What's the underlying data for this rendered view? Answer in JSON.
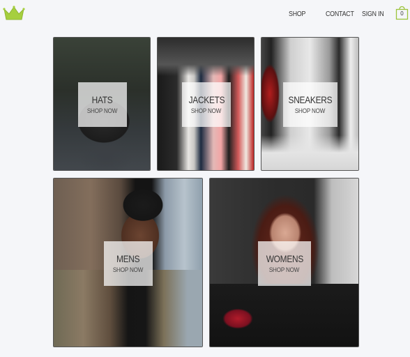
{
  "header": {
    "nav": {
      "shop": "SHOP",
      "contact": "CONTACT",
      "sign_in": "SIGN IN"
    },
    "cart": {
      "count": "0",
      "icon": "shopping-bag-icon"
    },
    "logo_icon": "crown-icon"
  },
  "colors": {
    "accent": "#a6cf3f",
    "background": "#f5f6f9",
    "text": "#333333"
  },
  "categories": [
    {
      "title": "HATS",
      "cta": "SHOP NOW"
    },
    {
      "title": "JACKETS",
      "cta": "SHOP NOW"
    },
    {
      "title": "SNEAKERS",
      "cta": "SHOP NOW"
    },
    {
      "title": "MENS",
      "cta": "SHOP NOW"
    },
    {
      "title": "WOMENS",
      "cta": "SHOP NOW"
    }
  ]
}
